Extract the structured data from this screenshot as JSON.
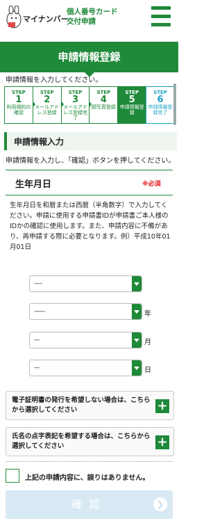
{
  "header": {
    "logo_text": "マイナンバー",
    "title_line1": "個人番号カード",
    "title_line2": "交付申請"
  },
  "page": {
    "title": "申請情報登録",
    "intro": "申請情報を入力してください。"
  },
  "steps": [
    {
      "label": "STEP",
      "num": "1",
      "text": "利用規約の確認",
      "state": "done"
    },
    {
      "label": "STEP",
      "num": "2",
      "text": "メールアドレス登録",
      "state": "done"
    },
    {
      "label": "STEP",
      "num": "3",
      "text": "メールアドレス登録完了",
      "state": "done"
    },
    {
      "label": "STEP",
      "num": "4",
      "text": "顔写真登録",
      "state": "done"
    },
    {
      "label": "STEP",
      "num": "5",
      "text": "申請情報登録",
      "state": "active"
    },
    {
      "label": "STEP",
      "num": "6",
      "text": "申請情報登録完了",
      "state": "future"
    }
  ],
  "section": {
    "title": "申請情報入力",
    "desc": "申請情報を入力し、「確認」ボタンを押してください。"
  },
  "field": {
    "label": "生年月日",
    "required": "※必須",
    "help": "生年月日を和暦または西暦（半角数字）で入力してください。申請に使用する申請書IDが申請書ご本人様のIDかの確認に使用します。また、申請内容に不備があり、再申請する際に必要となります。例）平成10年01月01日",
    "selects": [
      {
        "value": "------",
        "unit": ""
      },
      {
        "value": "--------",
        "unit": "年"
      },
      {
        "value": "----",
        "unit": "月"
      },
      {
        "value": "----",
        "unit": "日"
      }
    ]
  },
  "options": [
    {
      "text": "電子証明書の発行を希望しない場合は、こちらから選択してください",
      "icon": "plus-icon"
    },
    {
      "text": "氏名の点字表記を希望する場合は、こちらから選択してください",
      "icon": "plus-icon"
    }
  ],
  "agree": {
    "label": "上記の申請内容に、誤りはありません。"
  },
  "confirm": {
    "label": "確認",
    "icon": "chevron-right-icon"
  },
  "colors": {
    "primary": "#1f8a3a",
    "accent_future": "#20a3c9",
    "required": "#e21c1c",
    "confirm_disabled": "#d8e9f4"
  }
}
